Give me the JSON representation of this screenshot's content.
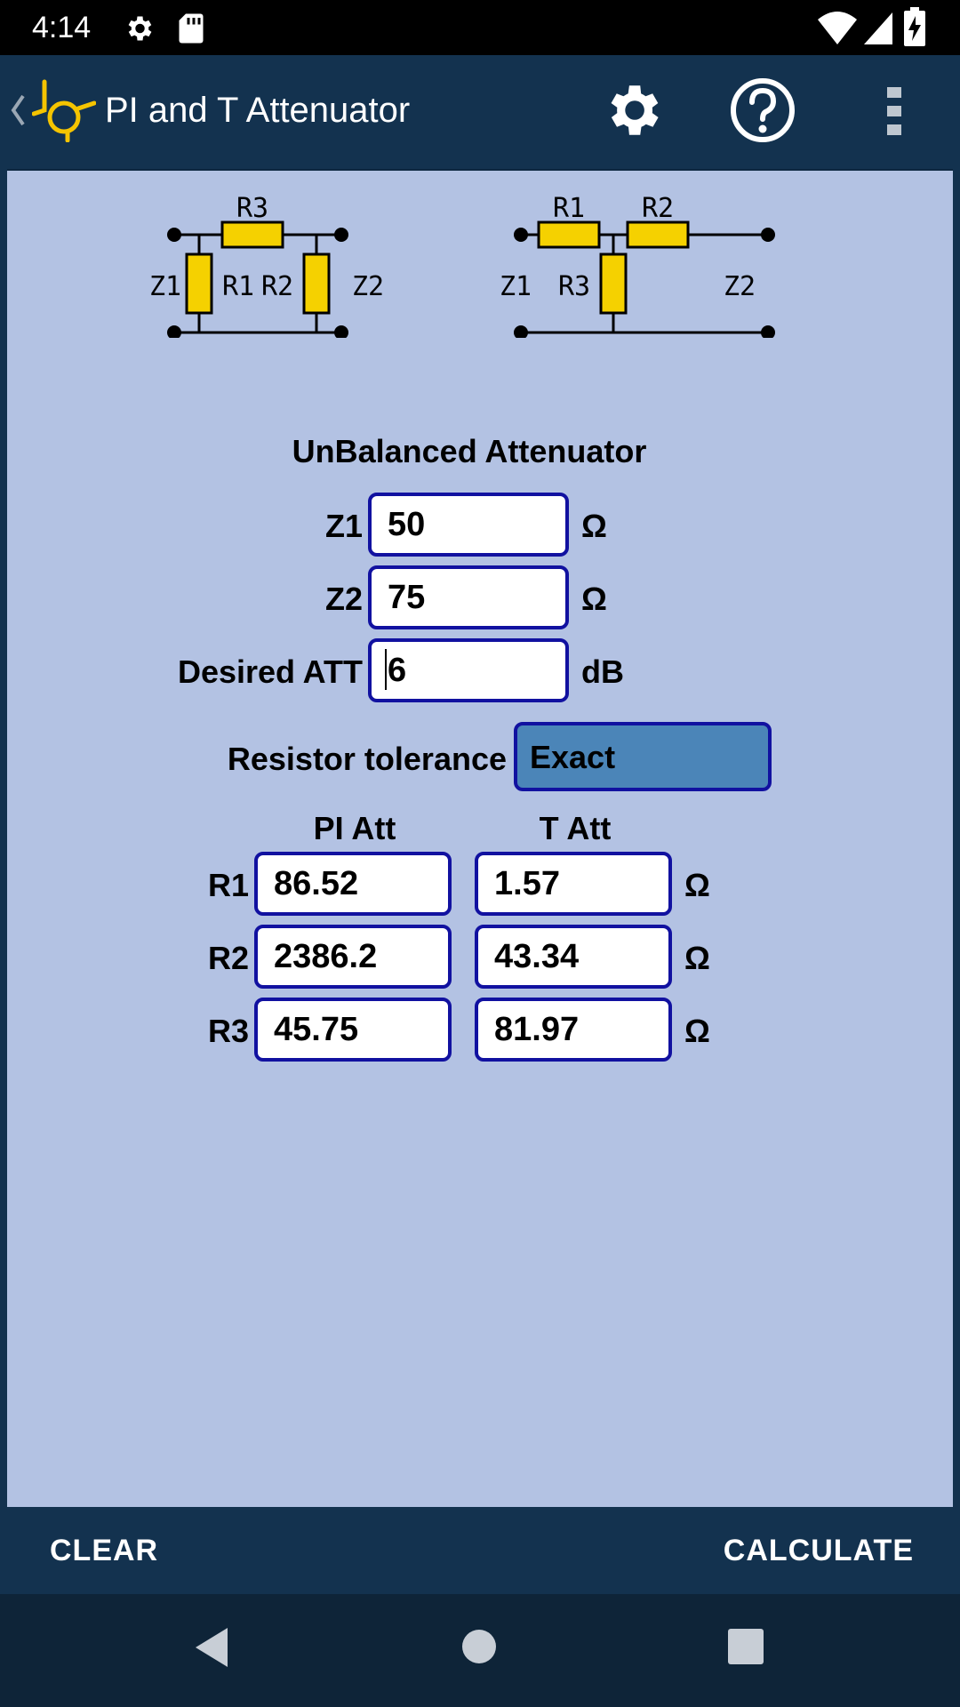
{
  "status_bar": {
    "time": "4:14",
    "icons_left": [
      "settings-gear-icon",
      "sd-card-icon"
    ],
    "icons_right": [
      "wifi-icon",
      "signal-icon",
      "battery-charging-icon"
    ]
  },
  "app_bar": {
    "title": "PI and T Attenuator",
    "actions": [
      "settings-icon",
      "help-icon",
      "overflow-menu-icon"
    ]
  },
  "diagram_pi": {
    "labels": {
      "top": "R3",
      "left_z": "Z1",
      "left_r": "R1",
      "right_r": "R2",
      "right_z": "Z2"
    }
  },
  "diagram_t": {
    "labels": {
      "top_left": "R1",
      "top_right": "R2",
      "left_z": "Z1",
      "mid_r": "R3",
      "right_z": "Z2"
    }
  },
  "form": {
    "heading": "UnBalanced Attenuator",
    "z1_label": "Z1",
    "z1_value": "50",
    "z1_unit": "Ω",
    "z2_label": "Z2",
    "z2_value": "75",
    "z2_unit": "Ω",
    "att_label": "Desired ATT",
    "att_value": "6",
    "att_unit": "dB",
    "tolerance_label": "Resistor tolerance",
    "tolerance_value": "Exact"
  },
  "results": {
    "pi_header": "PI Att",
    "t_header": "T Att",
    "rows": [
      {
        "label": "R1",
        "pi": "86.52",
        "t": "1.57",
        "unit": "Ω"
      },
      {
        "label": "R2",
        "pi": "2386.2",
        "t": "43.34",
        "unit": "Ω"
      },
      {
        "label": "R3",
        "pi": "45.75",
        "t": "81.97",
        "unit": "Ω"
      }
    ]
  },
  "bottom_bar": {
    "clear_label": "CLEAR",
    "calculate_label": "CALCULATE"
  },
  "colors": {
    "app_bar": "#13324f",
    "content_bg": "#b3c2e3",
    "field_border": "#1111a0",
    "select_bg": "#4b85b8",
    "resistor": "#f5d100",
    "logo": "#f5c400"
  }
}
